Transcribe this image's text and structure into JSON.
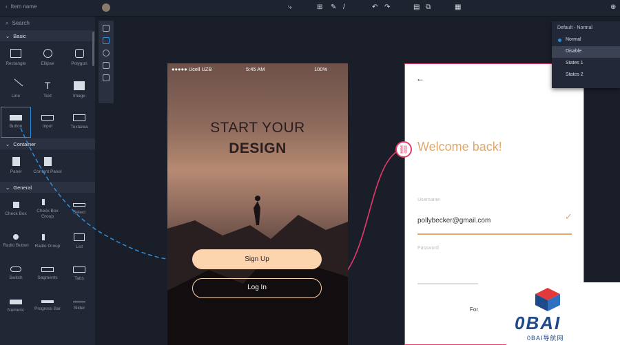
{
  "topbar": {
    "back_label": "Item name"
  },
  "search": {
    "placeholder": "Search"
  },
  "sections": {
    "basic": "Basic",
    "container": "Container",
    "general": "General"
  },
  "basic_items": [
    "Rectangle",
    "Ellipse",
    "Polygon",
    "Line",
    "Text",
    "Image",
    "Button",
    "Input",
    "Textarea"
  ],
  "container_items": [
    "Panel",
    "Content Panel"
  ],
  "general_items": [
    "Check Box",
    "Check Box Group",
    "Select",
    "Radio Button",
    "Radio Group",
    "List",
    "Switch",
    "Segments",
    "Tabs",
    "Numeric",
    "Progress Bar",
    "Slider"
  ],
  "phone": {
    "carrier": "Ucell UZB",
    "time": "5:45 AM",
    "battery": "100%",
    "headline1": "START YOUR",
    "headline2": "DESIGN",
    "signup": "Sign Up",
    "login": "Log In"
  },
  "login_screen": {
    "back_arrow": "←",
    "title": "Welcome back!",
    "username_label": "Username",
    "username_value": "pollybecker@gmail.com",
    "password_label": "Password",
    "footer_partial": "For"
  },
  "states": {
    "header": "Default - Normal",
    "items": [
      "Normal",
      "Disable",
      "States 1",
      "States 2"
    ]
  },
  "logo": {
    "text": "0BAI",
    "sub": "0BAI导航网"
  },
  "colors": {
    "accent": "#2a90e0",
    "link": "#e83a6a",
    "welcome": "#e0a86a",
    "button": "#fcd4ae"
  }
}
